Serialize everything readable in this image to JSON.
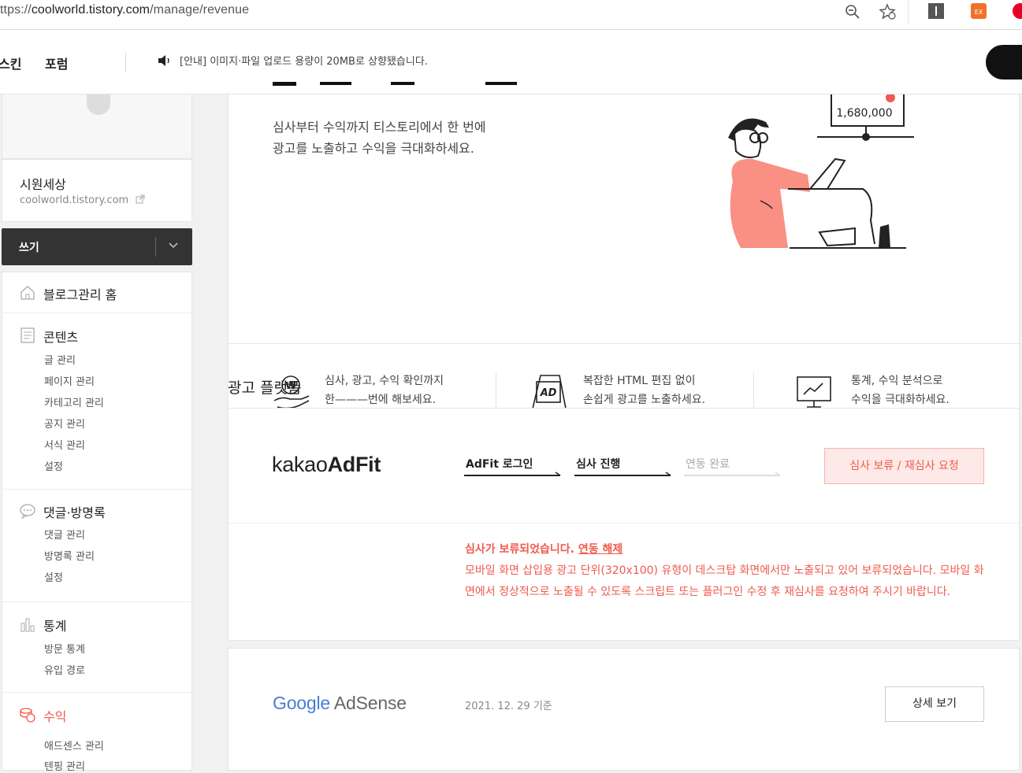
{
  "browser": {
    "url_prefix": "ttps://",
    "url_host": "coolworld.tistory.com",
    "url_path": "/manage/revenue"
  },
  "topnav": {
    "skin": "스킨",
    "forum": "포럼",
    "notice": "[안내] 이미지·파일 업로드 용량이 20MB로 상향됐습니다."
  },
  "blog": {
    "name": "시원세상",
    "url": "coolworld.tistory.com"
  },
  "write_button": "쓰기",
  "sidebar": {
    "home": "블로그관리 홈",
    "contents": {
      "title": "콘텐츠",
      "items": [
        "글 관리",
        "페이지 관리",
        "카테고리 관리",
        "공지 관리",
        "서식 관리",
        "설정"
      ]
    },
    "comments": {
      "title": "댓글·방명록",
      "items": [
        "댓글 관리",
        "방명록 관리",
        "설정"
      ]
    },
    "stats": {
      "title": "통계",
      "items": [
        "방문 통계",
        "유입 경로"
      ]
    },
    "revenue": {
      "title": "수익",
      "items": [
        "애드센스 관리",
        "텐핑 관리"
      ]
    }
  },
  "hero": {
    "desc_line1": "심사부터 수익까지 티스토리에서 한 번에",
    "desc_line2": "광고를 노출하고 수익을 극대화하세요.",
    "amount": "1,680,000"
  },
  "features": [
    {
      "line1": "심사, 광고, 수익 확인까지",
      "line2": "한———번에 해보세요."
    },
    {
      "line1": "복잡한 HTML 편집 없이",
      "line2": "손쉽게 광고를 노출하세요."
    },
    {
      "line1": "통계, 수익 분석으로",
      "line2": "수익을 극대화하세요."
    }
  ],
  "platform_title": "광고 플랫폼",
  "adfit": {
    "logo_light": "kakao",
    "logo_bold": "AdFit",
    "steps": [
      "AdFit 로그인",
      "심사 진행",
      "연동 완료"
    ],
    "button": "심사 보류 / 재심사 요청",
    "warn_head": "심사가 보류되었습니다. ",
    "warn_link": "연동 해제",
    "warn_body": "모바일 화면 삽입용 광고 단위(320x100) 유형이 데스크탑 화면에서만 노출되고 있어 보류되었습니다. 모바일 화면에서 정상적으로 노출될 수 있도록 스크립트 또는 플러그인 수정 후 재심사를 요청하여 주시기 바랍니다."
  },
  "adsense": {
    "logo_google": "Google",
    "logo_adsense": "AdSense",
    "date": "2021. 12. 29 기준",
    "button": "상세 보기"
  },
  "colors": {
    "accent": "#f05a4e",
    "dark": "#333333"
  }
}
